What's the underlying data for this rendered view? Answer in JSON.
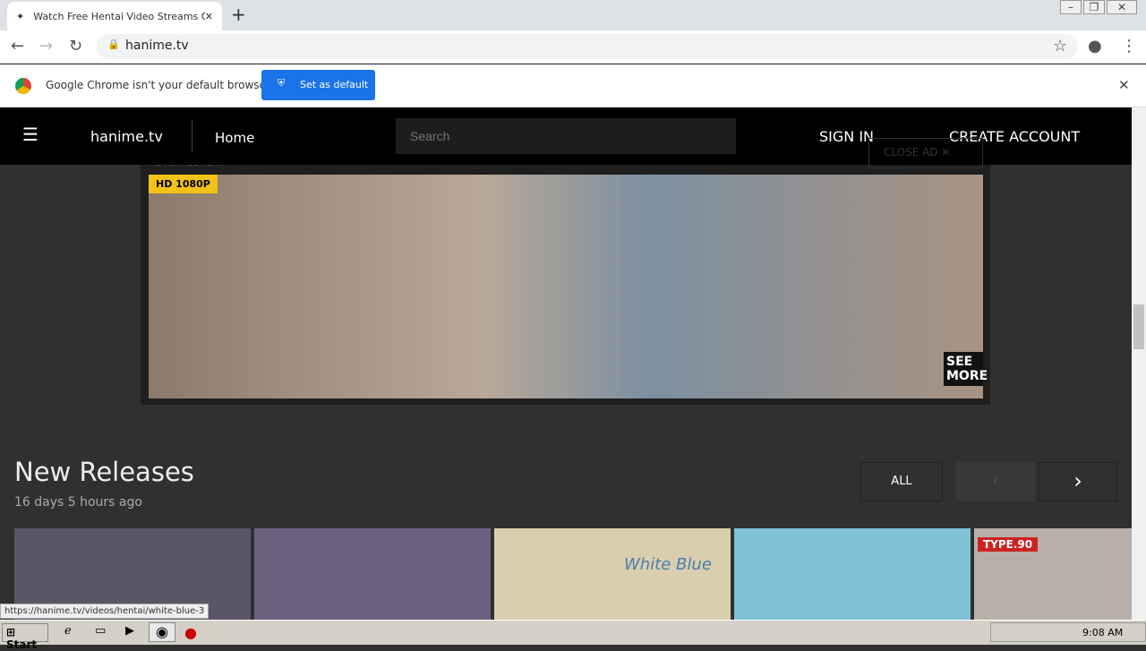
{
  "browser": {
    "tab_title": "Watch Free Hentai Video Streams Or",
    "url": "hanime.tv",
    "infobar_message": "Google Chrome isn't your default browser",
    "set_default_label": "Set as default",
    "status_url": "https://hanime.tv/videos/hentai/white-blue-3"
  },
  "site": {
    "logo": "hanime.tv",
    "nav_home": "Home",
    "search_placeholder": "Search",
    "sign_in": "SIGN IN",
    "create_account": "CREATE ACCOUNT",
    "ad_label": "ADVERTISEMENT",
    "close_ad": "CLOSE AD",
    "ad_badge": "HD 1080P",
    "ad_see_more": "SEE MORE"
  },
  "section": {
    "title": "New Releases",
    "subtitle": "16 days 5 hours ago",
    "all_label": "ALL"
  },
  "cards": [
    "",
    "",
    "White Blue",
    "",
    "TYPE.90"
  ],
  "taskbar": {
    "start": "Start",
    "clock": "9:08 AM"
  },
  "colors": {
    "accent": "#1a73e8",
    "site_bg": "#303030",
    "nav_bg": "#000000"
  }
}
